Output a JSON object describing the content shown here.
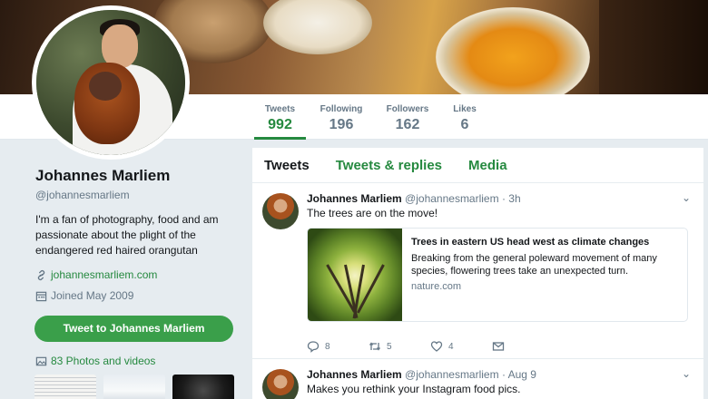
{
  "profile": {
    "name": "Johannes Marliem",
    "handle": "@johannesmarliem",
    "bio": "I'm a fan of photography, food and am passionate about the plight of the endangered red haired orangutan",
    "website": "johannesmarliem.com",
    "joined": "Joined May 2009",
    "tweet_to_label": "Tweet to Johannes Marliem",
    "photos_label": "83 Photos and videos"
  },
  "stats": [
    {
      "label": "Tweets",
      "value": "992"
    },
    {
      "label": "Following",
      "value": "196"
    },
    {
      "label": "Followers",
      "value": "162"
    },
    {
      "label": "Likes",
      "value": "6"
    }
  ],
  "tabs": [
    "Tweets",
    "Tweets & replies",
    "Media"
  ],
  "tweets": [
    {
      "name": "Johannes Marliem",
      "handle": "@johannesmarliem · 3h",
      "text": "The trees are on the move!",
      "card": {
        "title": "Trees in eastern US head west as climate changes",
        "description": "Breaking from the general poleward movement of many species, flowering trees take an unexpected turn.",
        "domain": "nature.com"
      },
      "actions": {
        "replies": "8",
        "retweets": "5",
        "likes": "4"
      }
    },
    {
      "name": "Johannes Marliem",
      "handle": "@johannesmarliem · Aug 9",
      "text": "Makes you rethink your Instagram food pics."
    }
  ],
  "colors": {
    "accent": "#25893f",
    "button": "#3a9f4a",
    "muted": "#657786"
  }
}
